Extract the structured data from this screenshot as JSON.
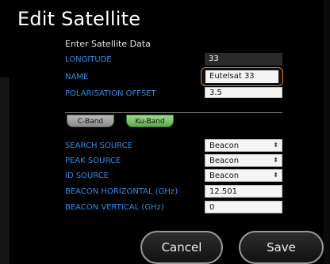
{
  "window": {
    "title": "Edit Satellite"
  },
  "form": {
    "heading": "Enter Satellite Data",
    "longitude": {
      "label": "LONGITUDE",
      "value": "33"
    },
    "name": {
      "label": "NAME",
      "value": "Eutelsat 33"
    },
    "polarisation": {
      "label": "POLARISATION OFFSET",
      "value": "3.5"
    }
  },
  "tabs": [
    {
      "label": "C-Band",
      "selected": false
    },
    {
      "label": "Ku-Band",
      "selected": true
    }
  ],
  "band_settings": {
    "search_source": {
      "label": "SEARCH SOURCE",
      "value": "Beacon"
    },
    "peak_source": {
      "label": "PEAK SOURCE",
      "value": "Beacon"
    },
    "id_source": {
      "label": "ID SOURCE",
      "value": "Beacon"
    },
    "beacon_horizontal": {
      "label": "BEACON HORIZONTAL (GHz)",
      "value": "12.501"
    },
    "beacon_vertical": {
      "label": "BEACON VERTICAL (GHz)",
      "value": "0"
    }
  },
  "buttons": {
    "cancel": "Cancel",
    "save": "Save"
  },
  "colors": {
    "label": "#2e8de6",
    "highlight": "#d97a2b",
    "ku_tab": "#5cab4b",
    "c_tab": "#8a8a8a"
  }
}
